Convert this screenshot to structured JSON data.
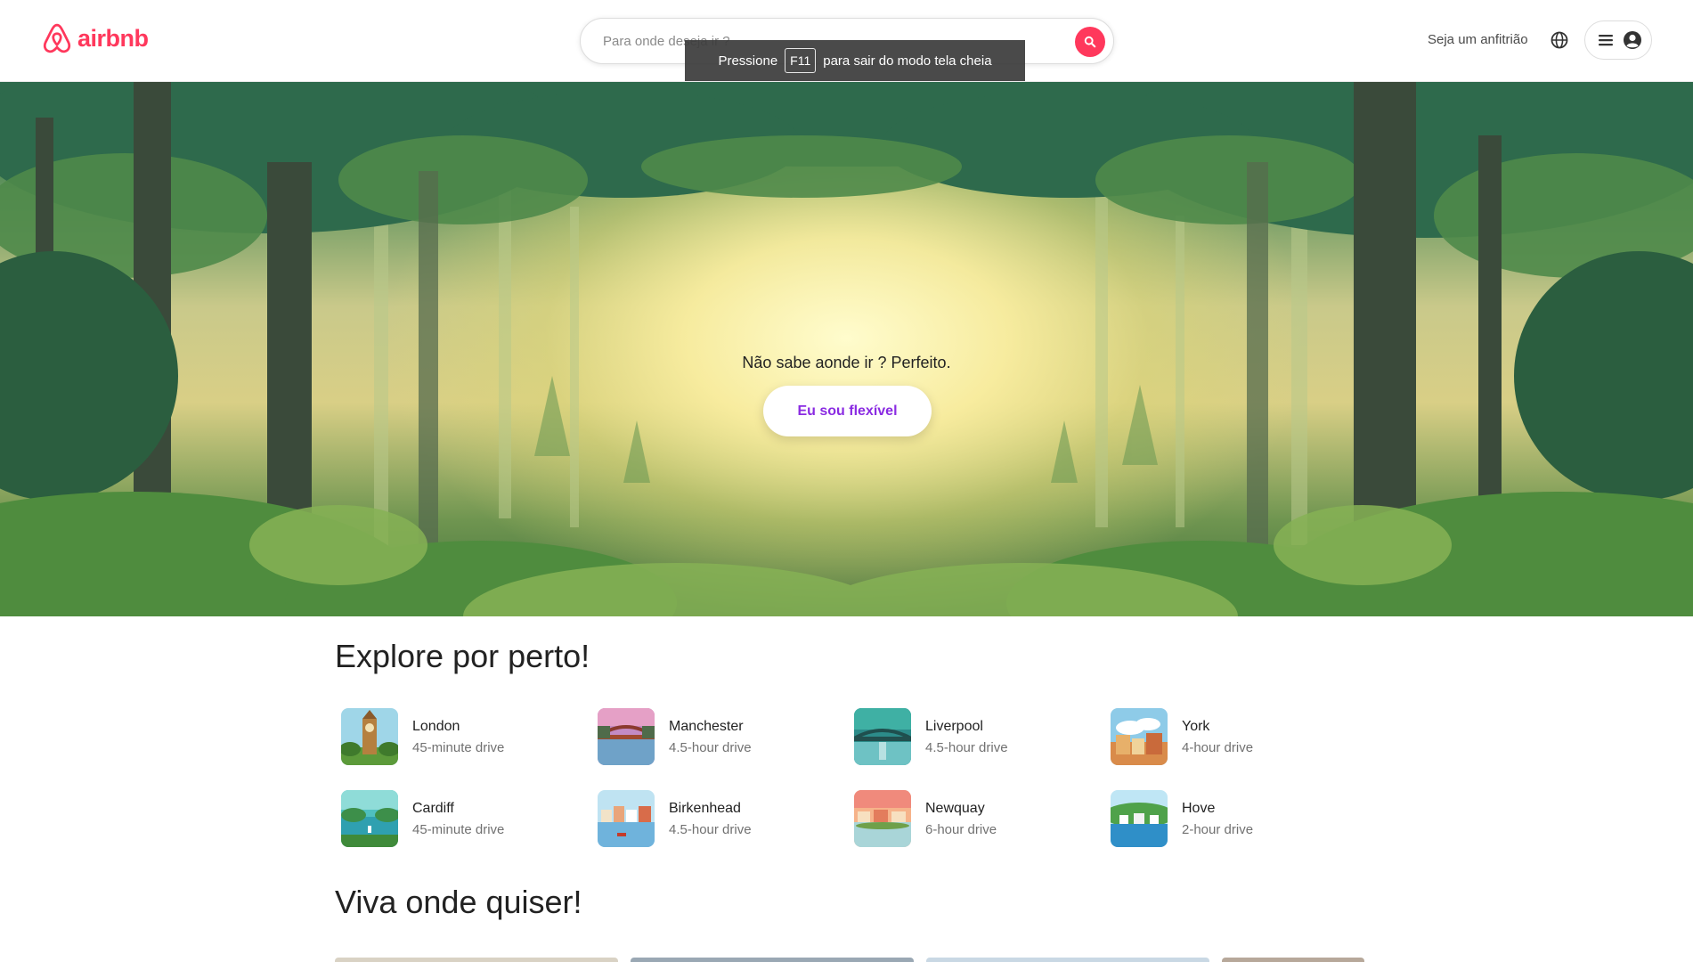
{
  "header": {
    "logo_text": "airbnb",
    "search_placeholder": "Para onde deseja ir ?",
    "host_link": "Seja um anfitrião",
    "icons": [
      "airbnb-logo-icon",
      "search-icon",
      "globe-icon",
      "menu-icon",
      "user-avatar-icon"
    ]
  },
  "toast": {
    "before": "Pressione",
    "key": "F11",
    "after": "para sair do modo tela cheia"
  },
  "hero": {
    "text": "Não sabe aonde ir ? Perfeito.",
    "button": "Eu sou flexível"
  },
  "explore": {
    "title": "Explore por perto!",
    "destinations": [
      {
        "name": "London",
        "time": "45-minute drive"
      },
      {
        "name": "Manchester",
        "time": "4.5-hour drive"
      },
      {
        "name": "Liverpool",
        "time": "4.5-hour drive"
      },
      {
        "name": "York",
        "time": "4-hour drive"
      },
      {
        "name": "Cardiff",
        "time": "45-minute drive"
      },
      {
        "name": "Birkenhead",
        "time": "4.5-hour drive"
      },
      {
        "name": "Newquay",
        "time": "6-hour drive"
      },
      {
        "name": "Hove",
        "time": "2-hour drive"
      }
    ]
  },
  "live": {
    "title": "Viva onde quiser!"
  },
  "colors": {
    "brand": "#ff385c",
    "accent_button_text": "#8a2be2",
    "text": "#222222",
    "muted": "#717171"
  }
}
